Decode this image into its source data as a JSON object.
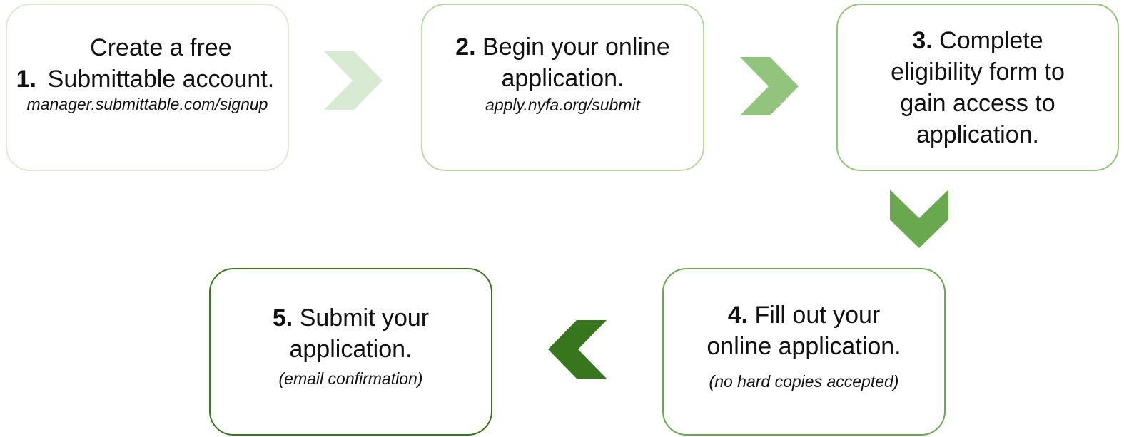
{
  "steps": [
    {
      "number": "1.",
      "title": "Create a free Submittable account.",
      "subtitle": "manager.submittable.com/signup",
      "border_color": "#dcebd4"
    },
    {
      "number": "2.",
      "title": "Begin your online application.",
      "subtitle": "apply.nyfa.org/submit",
      "border_color": "#b6d8a4"
    },
    {
      "number": "3.",
      "title": "Complete eligibility form to gain access to application.",
      "subtitle": "",
      "border_color": "#93c47d"
    },
    {
      "number": "4.",
      "title": "Fill out your online application.",
      "subtitle": "(no hard copies accepted)",
      "border_color": "#6aa84f"
    },
    {
      "number": "5.",
      "title": "Submit your application.",
      "subtitle": "(email confirmation)",
      "border_color": "#38761d"
    }
  ],
  "arrows": [
    {
      "icon": "chevron-right-icon",
      "color": "#d9ead3"
    },
    {
      "icon": "chevron-right-icon",
      "color": "#93c47d"
    },
    {
      "icon": "chevron-down-icon",
      "color": "#6aa84f"
    },
    {
      "icon": "chevron-left-icon",
      "color": "#38761d"
    }
  ]
}
